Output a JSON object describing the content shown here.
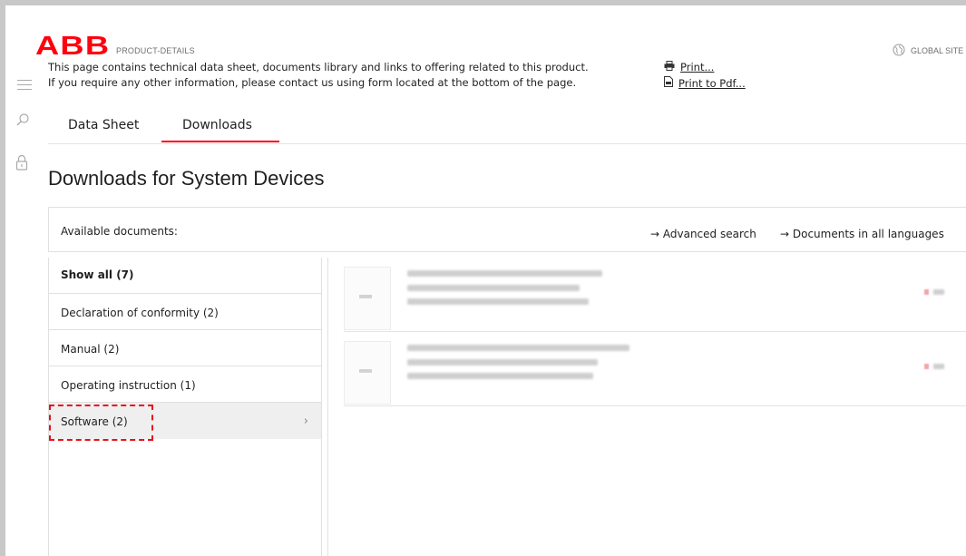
{
  "header": {
    "logo_text": "ABB",
    "breadcrumb": "PRODUCT-DETAILS",
    "global_site_label": "GLOBAL SITE",
    "intro_line1": "This page contains technical data sheet, documents library and links to offering related to this product.",
    "intro_line2": "If you require any other information, please contact us using form located at the bottom of the page.",
    "print_label": "Print...",
    "print_pdf_label": "Print to Pdf..."
  },
  "tabs": [
    {
      "label": "Data Sheet",
      "active": false
    },
    {
      "label": "Downloads",
      "active": true
    }
  ],
  "page_title": "Downloads for System Devices",
  "documents": {
    "available_label": "Available documents:",
    "advanced_search_label": "→ Advanced search",
    "all_languages_label": "→ Documents in all languages",
    "categories": [
      {
        "label": "Show all (7)"
      },
      {
        "label": "Declaration of conformity (2)"
      },
      {
        "label": "Manual (2)"
      },
      {
        "label": "Operating instruction (1)"
      },
      {
        "label": "Software (2)",
        "selected": true,
        "chevron": "›"
      }
    ]
  },
  "colors": {
    "brand_red": "#ff000f",
    "highlight_dashed": "#e8101a",
    "selected_bg": "#efefef"
  },
  "icons": [
    "menu-icon",
    "search-icon",
    "lock-icon",
    "globe-icon",
    "printer-icon",
    "pdf-icon",
    "chevron-right-icon"
  ]
}
